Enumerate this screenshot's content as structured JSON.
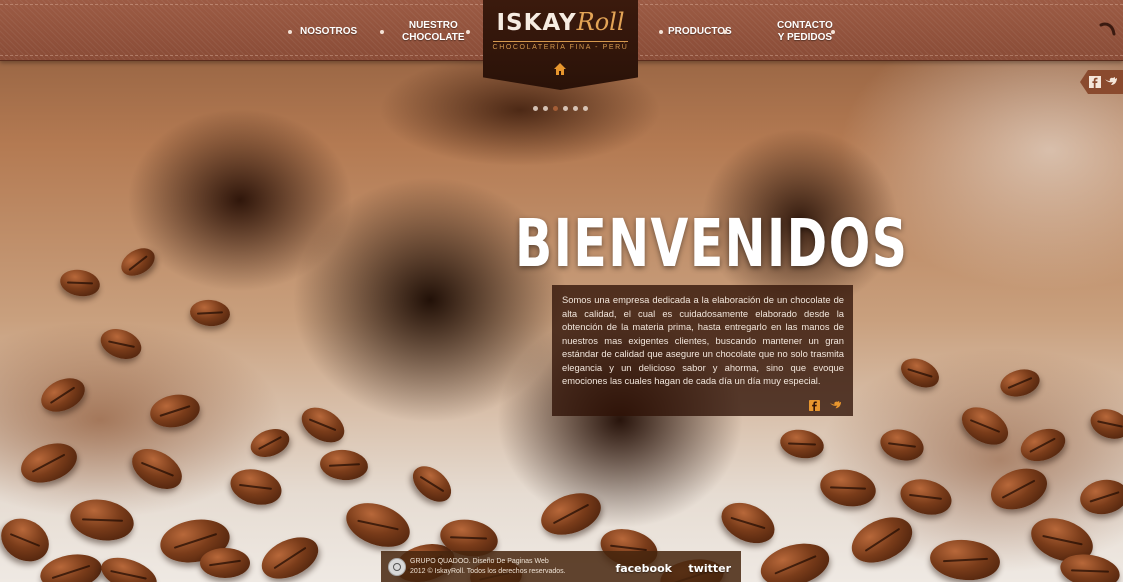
{
  "header": {
    "nav_left": [
      {
        "label": "NOSOTROS"
      },
      {
        "label": "NUESTRO\nCHOCOLATE"
      }
    ],
    "nav_right": [
      {
        "label": "PRODUCTOS"
      },
      {
        "label": "CONTACTO\nY PEDIDOS"
      }
    ],
    "logo": {
      "main": "ISKAY",
      "script": "Roll",
      "subtitle": "CHOCOLATERÍA FINA - PERÚ"
    }
  },
  "slider": {
    "dot_count": 6,
    "active_index": 2
  },
  "hero": {
    "heading": "BIENVENIDOS",
    "body": "Somos una empresa dedicada a la elaboración de un chocolate de alta calidad, el cual es cuidadosamente elaborado desde la obtención de la materia prima, hasta entregarlo en las manos de nuestros mas exigentes clientes, buscando mantener un gran estándar de calidad que asegure un chocolate que no solo trasmita elegancia y un delicioso sabor y ahorma, sino que evoque emociones las cuales hagan de cada día un día muy especial."
  },
  "footer": {
    "line1": "GRUPO QUADOO. Diseño De Paginas Web",
    "line2": "2012 © IskayRoll. Todos los derechos reservados.",
    "facebook": "facebook",
    "twitter": "twitter"
  },
  "colors": {
    "header": "#8a4c37",
    "logo_plate": "#2a1208",
    "accent_gold": "#d79a4f",
    "text_box": "#301206",
    "twitter_orange": "#e8962e"
  },
  "icons": [
    "home-icon",
    "facebook-icon",
    "twitter-icon",
    "corner-swirl-icon"
  ]
}
